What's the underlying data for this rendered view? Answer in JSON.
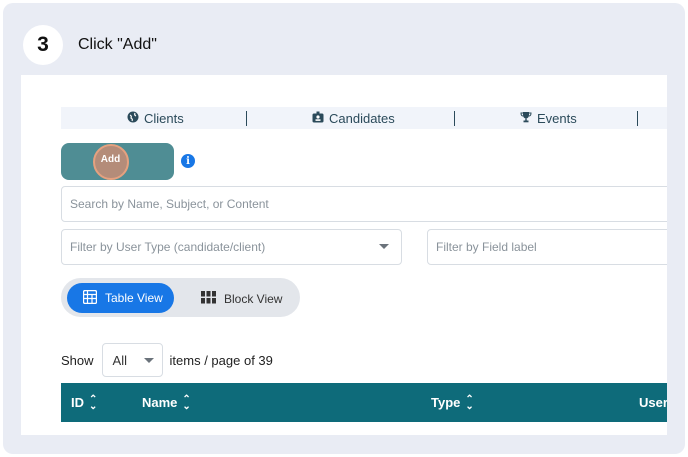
{
  "step": {
    "number": "3",
    "title": "Click \"Add\""
  },
  "nav": {
    "items": [
      {
        "label": "Clients",
        "icon": "globe-icon"
      },
      {
        "label": "Candidates",
        "icon": "id-badge-icon"
      },
      {
        "label": "Events",
        "icon": "trophy-icon"
      }
    ]
  },
  "toolbar": {
    "add_label": "Add"
  },
  "search": {
    "placeholder": "Search by Name, Subject, or Content"
  },
  "filters": {
    "user_type_placeholder": "Filter by User Type (candidate/client)",
    "field_label_placeholder": "Filter by Field label"
  },
  "view_toggle": {
    "table_label": "Table View",
    "block_label": "Block View"
  },
  "pagination": {
    "show_label": "Show",
    "selected": "All",
    "suffix": "items / page of 39"
  },
  "table": {
    "columns": [
      "ID",
      "Name",
      "Type",
      "User"
    ]
  },
  "colors": {
    "accent": "#1877e6",
    "header": "#0e6b7a",
    "add_button": "#4f8d94"
  }
}
